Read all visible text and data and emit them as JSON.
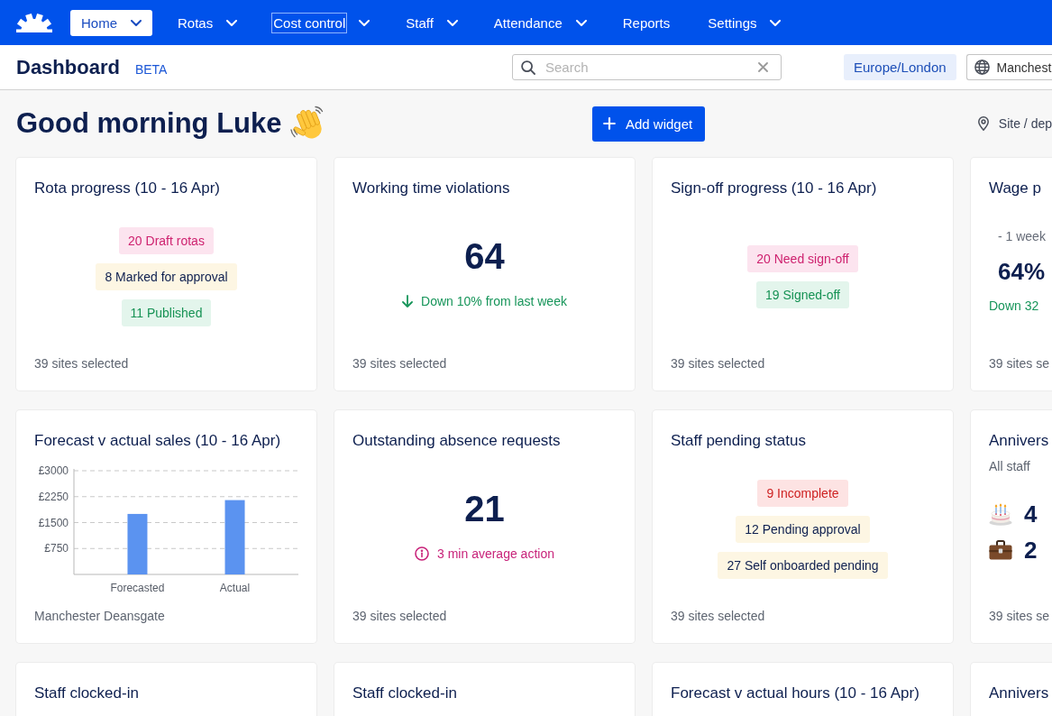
{
  "nav": {
    "items": [
      {
        "label": "Home",
        "selected": true,
        "focused": false,
        "dropdown": true
      },
      {
        "label": "Rotas",
        "selected": false,
        "focused": false,
        "dropdown": true
      },
      {
        "label": "Cost control",
        "selected": false,
        "focused": true,
        "dropdown": true
      },
      {
        "label": "Staff",
        "selected": false,
        "focused": false,
        "dropdown": true
      },
      {
        "label": "Attendance",
        "selected": false,
        "focused": false,
        "dropdown": true
      },
      {
        "label": "Reports",
        "selected": false,
        "focused": false,
        "dropdown": false
      },
      {
        "label": "Settings",
        "selected": false,
        "focused": false,
        "dropdown": true
      }
    ]
  },
  "header": {
    "title": "Dashboard",
    "badge": "BETA",
    "search": {
      "placeholder": "Search"
    },
    "timezone": "Europe/London",
    "location": "Manchest"
  },
  "greeting": {
    "text": "Good morning Luke",
    "add_button": "Add widget",
    "site_filter": "Site / dep"
  },
  "widgets": [
    {
      "kind": "pills",
      "title": "Rota progress (10 - 16 Apr)",
      "pills": [
        {
          "text": "20 Draft rotas",
          "color": "#fce4ef"
        },
        {
          "text": "8 Marked for approval",
          "color": "#fdf6e3"
        },
        {
          "text": "11 Published",
          "color": "#e3f5ec"
        }
      ],
      "footer": "39 sites selected"
    },
    {
      "kind": "stat",
      "title": "Working time violations",
      "value": "64",
      "note": {
        "kind": "trend_down",
        "text": "Down 10% from last week"
      },
      "footer": "39 sites selected"
    },
    {
      "kind": "pills",
      "title": "Sign-off progress (10 - 16 Apr)",
      "pills": [
        {
          "text": "20 Need sign-off",
          "color": "#fce4ef"
        },
        {
          "text": "19 Signed-off",
          "color": "#e3f5ec"
        }
      ],
      "footer": "39 sites selected"
    },
    {
      "kind": "comparison",
      "title": "Wage p",
      "period": "- 1 week",
      "value": "64%",
      "change": "Down 32",
      "footer": "39 sites se"
    },
    {
      "kind": "chart",
      "title": "Forecast v actual sales (10 - 16 Apr)",
      "chart_data": {
        "type": "bar",
        "categories": [
          "Forecasted",
          "Actual"
        ],
        "values": [
          1750,
          2150
        ],
        "ylim": [
          0,
          3000
        ],
        "yticks": [
          {
            "value": 750,
            "label": "£750"
          },
          {
            "value": 1500,
            "label": "£1500"
          },
          {
            "value": 2250,
            "label": "£2250"
          },
          {
            "value": 3000,
            "label": "£3000"
          }
        ],
        "grid": true
      },
      "footer": "Manchester Deansgate"
    },
    {
      "kind": "stat",
      "title": "Outstanding absence requests",
      "value": "21",
      "note": {
        "kind": "info",
        "text": "3 min average action"
      },
      "footer": "39 sites selected"
    },
    {
      "kind": "pills",
      "title": "Staff pending status",
      "pills": [
        {
          "text": "9 Incomplete",
          "color": "#fde3e3"
        },
        {
          "text": "12 Pending approval",
          "color": "#fdf6e3"
        },
        {
          "text": "27 Self onboarded pending",
          "color": "#fdf6e3"
        }
      ],
      "footer": "39 sites selected"
    },
    {
      "kind": "anniversary",
      "title": "Annivers",
      "subtitle": "All staff",
      "rows": [
        {
          "kind": "birthday",
          "text": "4"
        },
        {
          "kind": "work",
          "text": "2"
        }
      ],
      "footer": "39 sites se"
    },
    {
      "kind": "title",
      "title": "Staff clocked-in"
    },
    {
      "kind": "title",
      "title": "Staff clocked-in"
    },
    {
      "kind": "title",
      "title": "Forecast v actual hours (10 - 16 Apr)"
    },
    {
      "kind": "title",
      "title": "Annivers"
    }
  ]
}
